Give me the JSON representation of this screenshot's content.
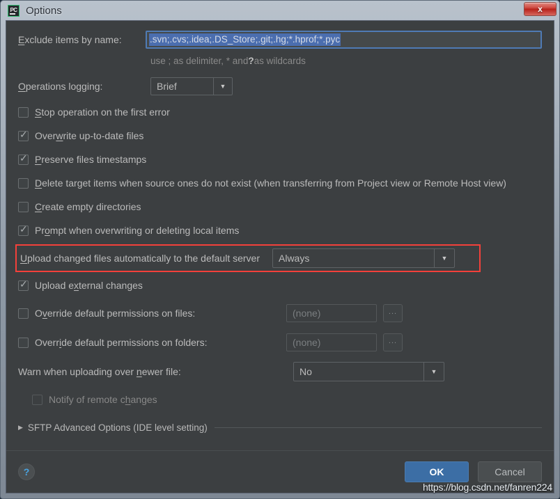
{
  "window": {
    "title": "Options",
    "app_icon": "pycharm-icon",
    "icon_text": "PC",
    "close_label": "x"
  },
  "exclude": {
    "label_prefix": "E",
    "label_rest": "xclude items by name:",
    "value": ".svn;.cvs;.idea;.DS_Store;.git;.hg;*.hprof;*.pyc",
    "hint_a": "use ; as delimiter, * and ",
    "hint_b": "?",
    "hint_c": " as wildcards"
  },
  "logging": {
    "label_prefix": "O",
    "label_rest": "perations logging:",
    "value": "Brief",
    "options": [
      "Brief"
    ],
    "arrow": "▼"
  },
  "checkboxes": [
    {
      "prefix": "S",
      "rest": "top operation on the first error",
      "checked": false,
      "disabled": false
    },
    {
      "prefix": "Over",
      "mnemonic": "w",
      "rest": "rite up-to-date files",
      "checked": true,
      "disabled": false
    },
    {
      "prefix": "P",
      "rest": "reserve files timestamps",
      "checked": true,
      "disabled": false
    },
    {
      "prefix": "D",
      "rest": "elete target items when source ones do not exist (when transferring from Project view or Remote Host view)",
      "checked": false,
      "disabled": false
    },
    {
      "prefix": "C",
      "rest": "reate empty directories",
      "checked": false,
      "disabled": false
    },
    {
      "prefix": "Pr",
      "mnemonic": "o",
      "rest": "mpt when overwriting or deleting local items",
      "checked": true,
      "disabled": false
    }
  ],
  "upload_row": {
    "label_prefix": "U",
    "label_rest": "pload changed files automatically to the default server",
    "value": "Always",
    "options": [
      "Always"
    ],
    "arrow": "▼",
    "highlight_color": "#f4403a"
  },
  "upload_external": {
    "prefix": "Upload e",
    "mnemonic": "x",
    "rest": "ternal changes",
    "checked": true
  },
  "permissions": [
    {
      "prefix": "O",
      "mnemonic": "v",
      "rest": "erride default permissions on files:",
      "checked": false,
      "value": "(none)",
      "browse_label": "..."
    },
    {
      "prefix": "Overr",
      "mnemonic": "i",
      "rest": "de default permissions on folders:",
      "checked": false,
      "value": "(none)",
      "browse_label": "..."
    }
  ],
  "warn_row": {
    "label_a": "Warn when uploading over ",
    "mnemonic": "n",
    "label_b": "ewer file:",
    "value": "No",
    "options": [
      "No"
    ],
    "arrow": "▼"
  },
  "notify_row": {
    "prefix": "Notify of remote c",
    "mnemonic": "h",
    "rest": "anges",
    "checked": false,
    "disabled": true
  },
  "section": {
    "triangle": "▶",
    "label": "SFTP Advanced Options (IDE level setting)"
  },
  "bottom": {
    "help_icon": "help-icon",
    "help_glyph": "?",
    "ok_label": "OK",
    "cancel_label": "Cancel",
    "ok_color": "#3c6ea5"
  },
  "watermark": "https://blog.csdn.net/fanren224"
}
